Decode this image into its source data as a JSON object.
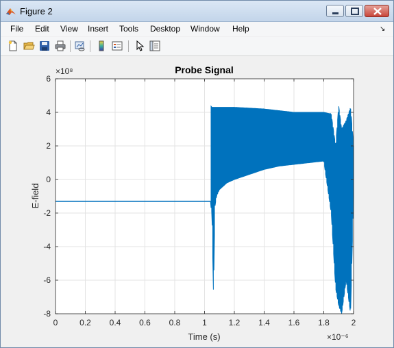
{
  "window": {
    "title": "Figure 2"
  },
  "menu": [
    "File",
    "Edit",
    "View",
    "Insert",
    "Tools",
    "Desktop",
    "Window",
    "Help"
  ],
  "toolbar_icons": [
    "new-figure-icon",
    "open-file-icon",
    "save-icon",
    "print-icon",
    "link-plot-icon",
    "colorbar-icon",
    "legend-icon",
    "select-arrow-icon",
    "property-inspector-icon"
  ],
  "colors": {
    "series": "#0072bd"
  },
  "chart_data": {
    "type": "line",
    "title": "Probe Signal",
    "xlabel": "Time (s)",
    "ylabel": "E-field",
    "x_multiplier": "×10⁻⁶",
    "y_multiplier": "×10⁸",
    "xlim": [
      0,
      2
    ],
    "ylim": [
      -8,
      6
    ],
    "xticks": [
      "0",
      "0.2",
      "0.4",
      "0.6",
      "0.8",
      "1",
      "1.2",
      "1.4",
      "1.6",
      "1.8",
      "2"
    ],
    "yticks": [
      "-8",
      "-6",
      "-4",
      "-2",
      "0",
      "2",
      "4",
      "6"
    ],
    "grid": true,
    "series": [
      {
        "points_x": [
          0,
          1.04,
          1.04,
          1.05,
          1.06,
          1.07,
          1.08,
          1.1,
          1.15,
          1.2,
          1.3,
          1.4,
          1.5,
          1.6,
          1.7,
          1.8,
          1.85,
          1.88,
          1.9,
          1.92,
          1.95,
          1.98,
          2.0
        ],
        "upper": [
          -1.3,
          -1.3,
          4.4,
          4.3,
          4.3,
          4.3,
          4.3,
          4.3,
          4.3,
          4.3,
          4.25,
          4.2,
          4.1,
          4.0,
          4.0,
          4.0,
          3.9,
          2.0,
          4.4,
          3.0,
          3.5,
          4.3,
          2.0
        ],
        "lower": [
          -1.3,
          -1.3,
          -1.5,
          -2.0,
          -7.0,
          -1.6,
          -1.0,
          -0.6,
          -0.2,
          0.0,
          0.3,
          0.6,
          0.8,
          0.9,
          1.0,
          1.1,
          -2.0,
          -6.5,
          -7.5,
          -8.0,
          -6.0,
          -8.0,
          -1.0
        ]
      }
    ]
  }
}
